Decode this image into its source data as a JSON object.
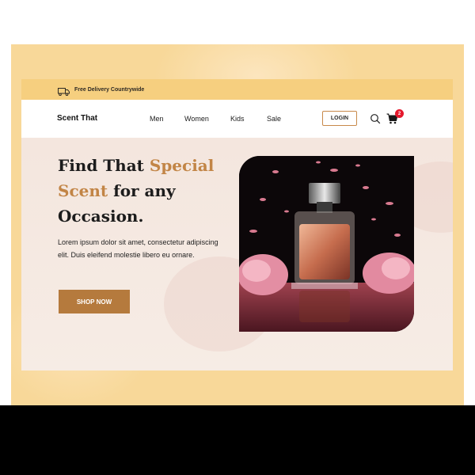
{
  "topbar": {
    "delivery_text": "Free Delivery Countrywide"
  },
  "nav": {
    "brand": "Scent That",
    "menu": [
      {
        "label": "Men"
      },
      {
        "label": "Women"
      },
      {
        "label": "Kids"
      },
      {
        "label": "Sale"
      }
    ],
    "login_label": "LOGIN",
    "cart_count": "2"
  },
  "hero": {
    "headline_part1": "Find That ",
    "headline_accent1": "Special",
    "headline_accent2": "Scent",
    "headline_part2": " for any",
    "headline_part3": "Occasion.",
    "description": "Lorem ipsum dolor sit amet, consectetur adipiscing elit. Duis eleifend molestie libero eu ornare.",
    "cta_label": "SHOP NOW"
  },
  "colors": {
    "accent": "#c28546",
    "button": "#b57a3d",
    "topbar": "#f6cf7f",
    "badge": "#e5192d"
  },
  "icons": [
    "truck-icon",
    "search-icon",
    "cart-icon"
  ]
}
